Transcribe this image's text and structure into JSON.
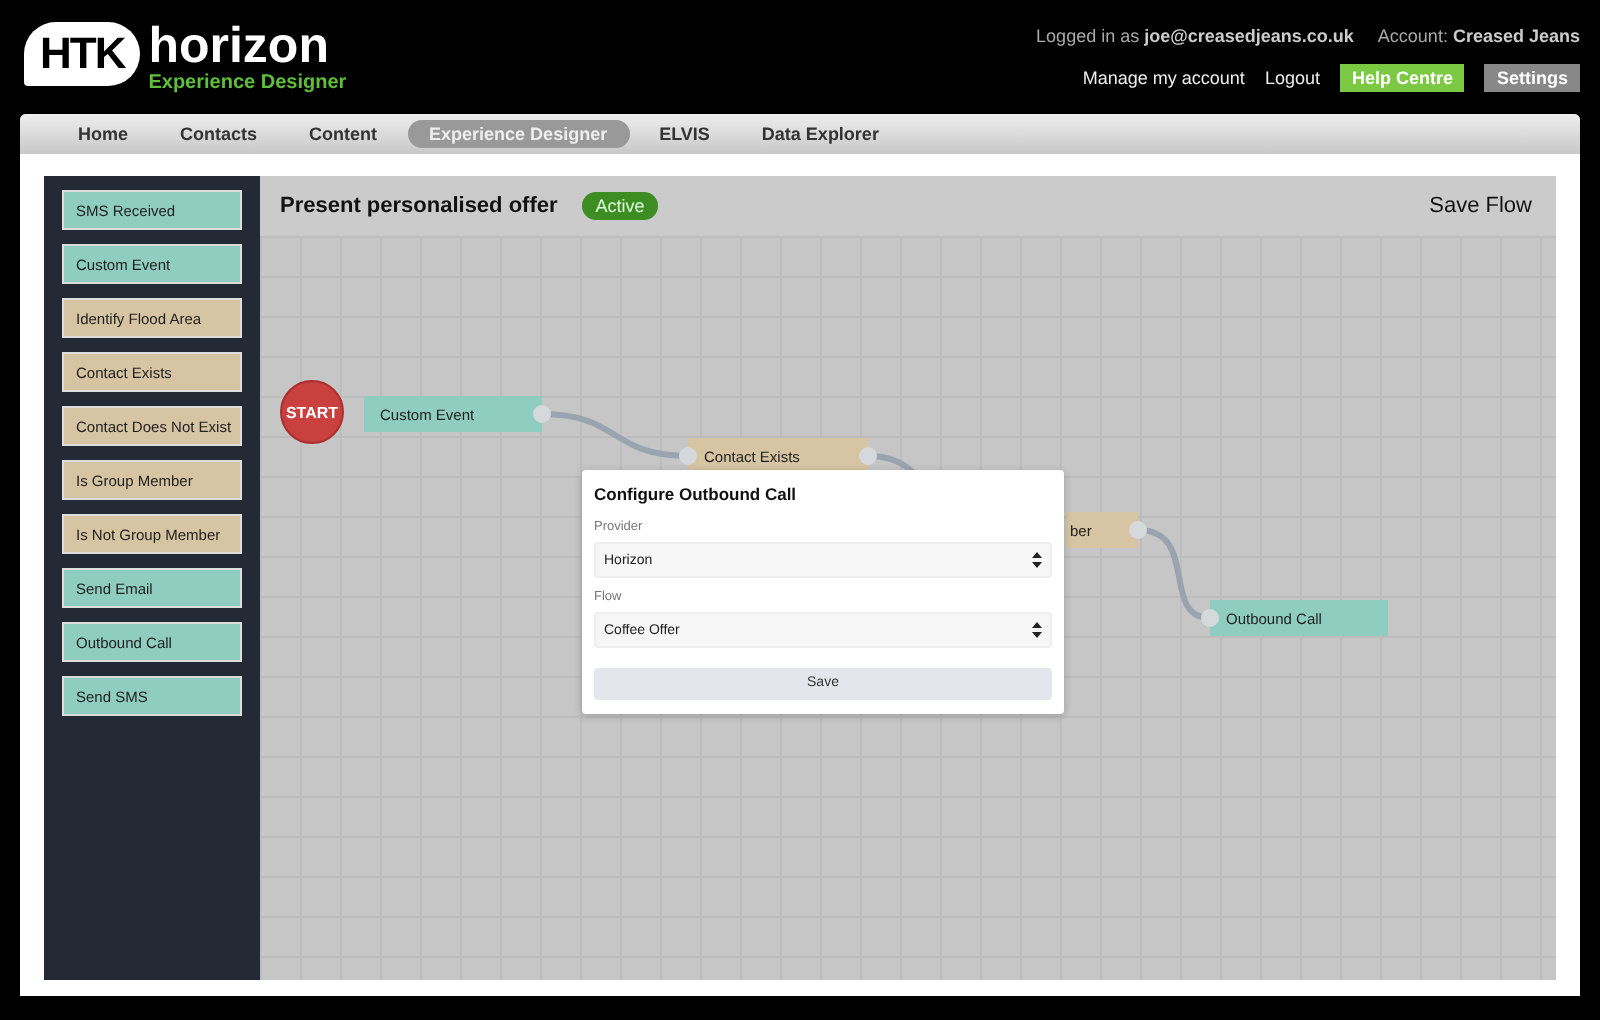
{
  "header": {
    "logo": {
      "mark": "HTK",
      "name": "horizon",
      "tagline": "Experience Designer"
    },
    "user": {
      "logged_in_label": "Logged in as",
      "email": "joe@creasedjeans.co.uk",
      "account_label": "Account:",
      "account": "Creased Jeans"
    },
    "links": [
      "Manage my account",
      "Logout"
    ],
    "buttons": [
      {
        "label": "Help Centre",
        "kind": "help"
      },
      {
        "label": "Settings",
        "kind": "settings"
      }
    ]
  },
  "nav": [
    {
      "label": "Home",
      "selected": false
    },
    {
      "label": "Contacts",
      "selected": false
    },
    {
      "label": "Content",
      "selected": false
    },
    {
      "label": "Experience Designer",
      "selected": true
    },
    {
      "label": "ELVIS",
      "selected": false
    },
    {
      "label": "Data Explorer",
      "selected": false
    }
  ],
  "palette": [
    {
      "label": "SMS Received",
      "kind": "event"
    },
    {
      "label": "Custom Event",
      "kind": "event"
    },
    {
      "label": "Identify Flood Area",
      "kind": "condition"
    },
    {
      "label": "Contact Exists",
      "kind": "condition"
    },
    {
      "label": "Contact Does Not Exist",
      "kind": "condition"
    },
    {
      "label": "Is Group Member",
      "kind": "condition"
    },
    {
      "label": "Is Not Group Member",
      "kind": "condition"
    },
    {
      "label": "Send Email",
      "kind": "event"
    },
    {
      "label": "Outbound Call",
      "kind": "event"
    },
    {
      "label": "Send SMS",
      "kind": "event"
    }
  ],
  "flow": {
    "title": "Present personalised offer",
    "status": "Active",
    "save": "Save Flow"
  },
  "canvas": {
    "nodes": [
      {
        "label": "START",
        "kind": "start"
      },
      {
        "label": "Custom Event",
        "kind": "event"
      },
      {
        "label": "Contact Exists",
        "kind": "condition"
      },
      {
        "label": "ber",
        "kind": "condition"
      },
      {
        "label": "Outbound Call",
        "kind": "event"
      }
    ]
  },
  "dialog": {
    "title": "Configure Outbound Call",
    "fields": [
      {
        "label": "Provider",
        "value": "Horizon"
      },
      {
        "label": "Flow",
        "value": "Coffee Offer"
      }
    ],
    "button": "Save"
  }
}
